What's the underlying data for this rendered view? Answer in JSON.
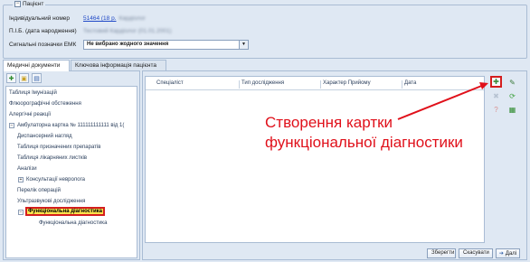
{
  "patient": {
    "title": "Пацієнт",
    "fields": [
      {
        "label": "Індивідуальний номер",
        "value": "51464 (18 р.",
        "blur": "Кардіолог"
      },
      {
        "label": "П.І.Б. (дата народження)",
        "value": "Тестовий Кардіолог (01.01.2001)"
      },
      {
        "label": "Сигнальні позначки ЕМК",
        "select": "Не вибрано жодного значення"
      }
    ]
  },
  "tabs": [
    "Медичні документи",
    "Ключова інформація пацієнта"
  ],
  "tree": [
    {
      "label": "Таблиця Імунізацій"
    },
    {
      "label": "Флюорографічні обстеження"
    },
    {
      "label": "Алергічні реакції"
    },
    {
      "label": "Амбулаторна картка № 111111111111 від 1(",
      "expander": "−"
    },
    {
      "label": "Диспансерний нагляд"
    },
    {
      "label": "Таблиця призначених препаратів"
    },
    {
      "label": "Таблиця лікарняних листків"
    },
    {
      "label": "Аналізи"
    },
    {
      "label": "Консультації невролога",
      "expander": "+"
    },
    {
      "label": "Перелік операцій"
    },
    {
      "label": "Ультразвукові дослідження"
    },
    {
      "label": "Функціональна діагностика",
      "expander": "−",
      "highlight": true
    },
    {
      "label": "Функціональна діагностика"
    }
  ],
  "grid": {
    "columns": [
      "Спеціаліст",
      "Тип дослідження",
      "Характер Прийому",
      "Дата"
    ]
  },
  "buttons": {
    "save": "Зберегти",
    "cancel": "Скасувати",
    "next": "Далі"
  },
  "annotation": [
    "Створення картки",
    "функціональної діагностики"
  ],
  "colors": {
    "highlight_border": "#d41e1e",
    "highlight_fill": "#ffe34d",
    "annotation": "#e0101a"
  },
  "icons": [
    "add-record-icon",
    "edit-icon",
    "delete-icon",
    "refresh-icon",
    "help-icon",
    "export-icon"
  ]
}
